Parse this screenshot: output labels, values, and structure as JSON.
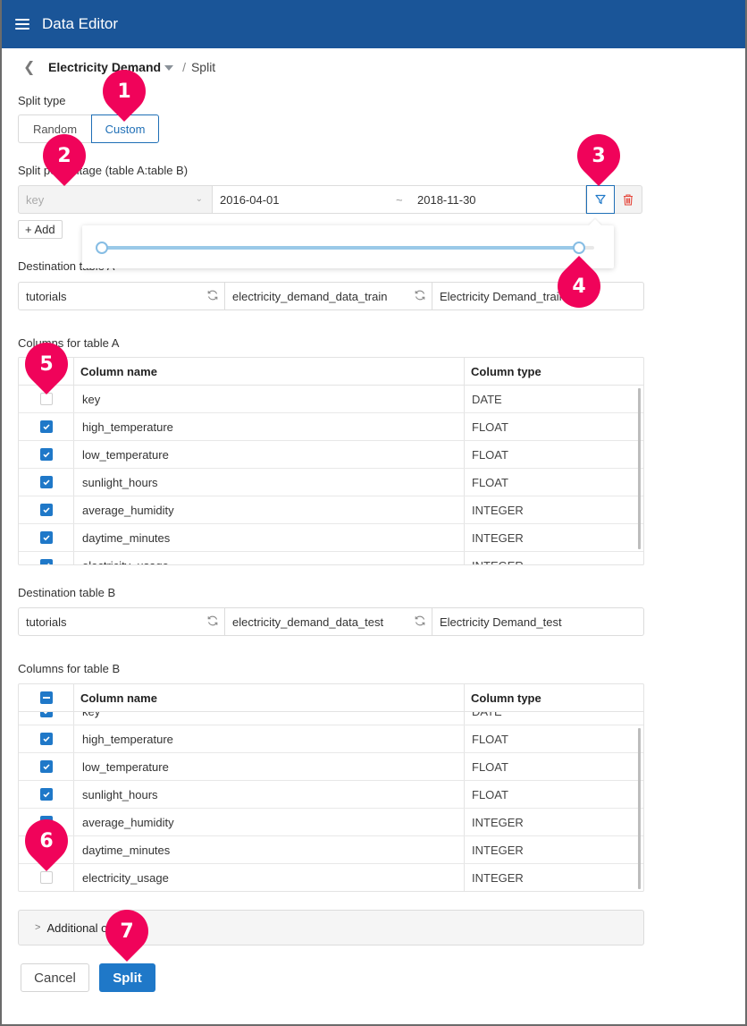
{
  "app": {
    "title": "Data Editor",
    "menu_icon": "hamburger-menu-icon"
  },
  "breadcrumb": {
    "back_icon": "chevron-left-icon",
    "project": "Electricity Demand",
    "separator": "/",
    "page": "Split"
  },
  "split_type": {
    "label": "Split type",
    "options": [
      "Random",
      "Custom"
    ],
    "selected": "Custom"
  },
  "split_percentage": {
    "label": "Split percentage (table A:table B)",
    "key_placeholder": "key",
    "from_date": "2016-04-01",
    "range_separator": "~",
    "to_date": "2018-11-30",
    "filter_icon": "filter-icon",
    "delete_icon": "trash-icon",
    "add_label": "+ Add",
    "slider": {
      "low": 0.0,
      "high": 0.97
    }
  },
  "destination_a": {
    "label": "Destination table A",
    "database": "tutorials",
    "table": "electricity_demand_data_train",
    "display_name": "Electricity Demand_train"
  },
  "columns_a": {
    "label": "Columns for table A",
    "header": {
      "name": "Column name",
      "type": "Column type"
    },
    "rows": [
      {
        "name": "key",
        "type": "DATE",
        "checked": false
      },
      {
        "name": "high_temperature",
        "type": "FLOAT",
        "checked": true
      },
      {
        "name": "low_temperature",
        "type": "FLOAT",
        "checked": true
      },
      {
        "name": "sunlight_hours",
        "type": "FLOAT",
        "checked": true
      },
      {
        "name": "average_humidity",
        "type": "INTEGER",
        "checked": true
      },
      {
        "name": "daytime_minutes",
        "type": "INTEGER",
        "checked": true
      },
      {
        "name": "electricity_usage",
        "type": "INTEGER",
        "checked": true
      }
    ]
  },
  "destination_b": {
    "label": "Destination table B",
    "database": "tutorials",
    "table": "electricity_demand_data_test",
    "display_name": "Electricity Demand_test"
  },
  "columns_b": {
    "label": "Columns for table B",
    "header": {
      "name": "Column name",
      "type": "Column type"
    },
    "rows": [
      {
        "name": "key",
        "type": "DATE",
        "checked": true
      },
      {
        "name": "high_temperature",
        "type": "FLOAT",
        "checked": true
      },
      {
        "name": "low_temperature",
        "type": "FLOAT",
        "checked": true
      },
      {
        "name": "sunlight_hours",
        "type": "FLOAT",
        "checked": true
      },
      {
        "name": "average_humidity",
        "type": "INTEGER",
        "checked": true
      },
      {
        "name": "daytime_minutes",
        "type": "INTEGER",
        "checked": true
      },
      {
        "name": "electricity_usage",
        "type": "INTEGER",
        "checked": false
      }
    ]
  },
  "additional": {
    "label": "Additional options"
  },
  "actions": {
    "cancel": "Cancel",
    "split": "Split"
  },
  "markers": [
    "1",
    "2",
    "3",
    "4",
    "5",
    "6",
    "7"
  ],
  "colors": {
    "appbar": "#1a5598",
    "accent": "#1f78c8",
    "marker": "#f0035a",
    "danger": "#e5483d"
  }
}
